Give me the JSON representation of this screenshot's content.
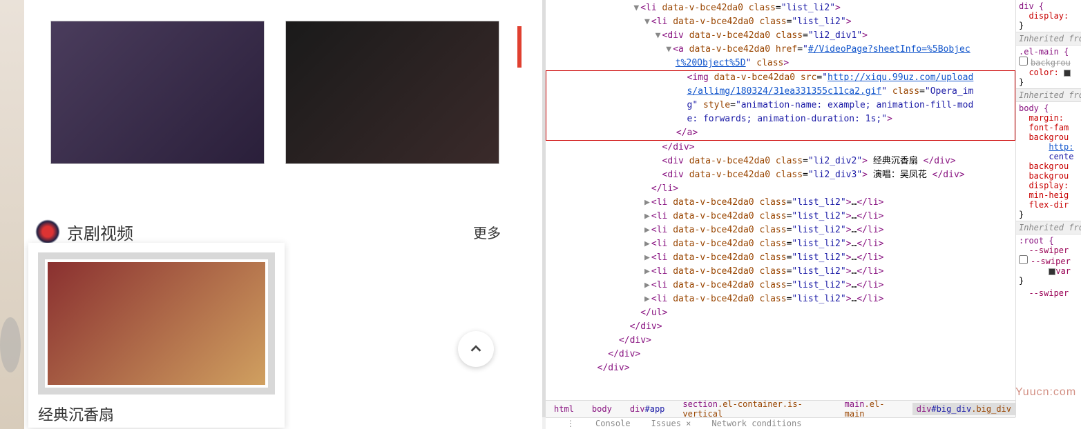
{
  "page": {
    "section_title": "京剧视频",
    "more_label": "更多",
    "card_caption": "经典沉香扇"
  },
  "devtools": {
    "lines": [
      {
        "indent": 8,
        "arrow": "▼",
        "pre": "<",
        "tag": "li",
        "attrs": [
          [
            "data-v-bce42da0",
            ""
          ],
          [
            "class",
            "list_li2"
          ]
        ],
        "post": ">",
        "fade": true,
        "partial_top": true
      },
      {
        "indent": 9,
        "arrow": "▼",
        "pre": "<",
        "tag": "li",
        "attrs": [
          [
            "data-v-bce42da0",
            ""
          ],
          [
            "class",
            "list_li2"
          ]
        ],
        "post": ">"
      },
      {
        "indent": 10,
        "arrow": "▼",
        "pre": "<",
        "tag": "div",
        "attrs": [
          [
            "data-v-bce42da0",
            ""
          ],
          [
            "class",
            "li2_div1"
          ]
        ],
        "post": ">"
      },
      {
        "indent": 11,
        "arrow": "▼",
        "pre": "<",
        "tag": "a",
        "attrs": [
          [
            "data-v-bce42da0",
            ""
          ]
        ],
        "href": "#/VideoPage?sheetInfo=%5Bobject%20Object%5D",
        "trail_attrs": [
          [
            "class",
            ""
          ]
        ],
        "post": "",
        "multiline_a": true
      },
      {
        "indent": 12,
        "arrow": "",
        "img_open": true,
        "box_start": true
      },
      {
        "indent": 12,
        "img_cont1": true
      },
      {
        "indent": 12,
        "img_cont2": true
      },
      {
        "indent": 12,
        "close_a": true,
        "box_end": true
      },
      {
        "indent": 10,
        "arrow": "",
        "pre": "</",
        "tag": "div",
        "post": ">"
      },
      {
        "indent": 10,
        "arrow": "",
        "pre": "<",
        "tag": "div",
        "attrs": [
          [
            "data-v-bce42da0",
            ""
          ],
          [
            "class",
            "li2_div2"
          ]
        ],
        "post": ">",
        "text": " 经典沉香扇 ",
        "close": "div"
      },
      {
        "indent": 10,
        "arrow": "",
        "pre": "<",
        "tag": "div",
        "attrs": [
          [
            "data-v-bce42da0",
            ""
          ],
          [
            "class",
            "li2_div3"
          ]
        ],
        "post": ">",
        "text": " 演唱：吴凤花 ",
        "close": "div"
      },
      {
        "indent": 9,
        "arrow": "",
        "pre": "</",
        "tag": "li",
        "post": ">"
      },
      {
        "indent": 9,
        "arrow": "▶",
        "pre": "<",
        "tag": "li",
        "attrs": [
          [
            "data-v-bce42da0",
            ""
          ],
          [
            "class",
            "list_li2"
          ]
        ],
        "post": ">",
        "ell": true,
        "close": "li"
      },
      {
        "indent": 9,
        "arrow": "▶",
        "pre": "<",
        "tag": "li",
        "attrs": [
          [
            "data-v-bce42da0",
            ""
          ],
          [
            "class",
            "list_li2"
          ]
        ],
        "post": ">",
        "ell": true,
        "close": "li"
      },
      {
        "indent": 9,
        "arrow": "▶",
        "pre": "<",
        "tag": "li",
        "attrs": [
          [
            "data-v-bce42da0",
            ""
          ],
          [
            "class",
            "list_li2"
          ]
        ],
        "post": ">",
        "ell": true,
        "close": "li"
      },
      {
        "indent": 9,
        "arrow": "▶",
        "pre": "<",
        "tag": "li",
        "attrs": [
          [
            "data-v-bce42da0",
            ""
          ],
          [
            "class",
            "list_li2"
          ]
        ],
        "post": ">",
        "ell": true,
        "close": "li"
      },
      {
        "indent": 9,
        "arrow": "▶",
        "pre": "<",
        "tag": "li",
        "attrs": [
          [
            "data-v-bce42da0",
            ""
          ],
          [
            "class",
            "list_li2"
          ]
        ],
        "post": ">",
        "ell": true,
        "close": "li"
      },
      {
        "indent": 9,
        "arrow": "▶",
        "pre": "<",
        "tag": "li",
        "attrs": [
          [
            "data-v-bce42da0",
            ""
          ],
          [
            "class",
            "list_li2"
          ]
        ],
        "post": ">",
        "ell": true,
        "close": "li"
      },
      {
        "indent": 9,
        "arrow": "▶",
        "pre": "<",
        "tag": "li",
        "attrs": [
          [
            "data-v-bce42da0",
            ""
          ],
          [
            "class",
            "list_li2"
          ]
        ],
        "post": ">",
        "ell": true,
        "close": "li"
      },
      {
        "indent": 9,
        "arrow": "▶",
        "pre": "<",
        "tag": "li",
        "attrs": [
          [
            "data-v-bce42da0",
            ""
          ],
          [
            "class",
            "list_li2"
          ]
        ],
        "post": ">",
        "ell": true,
        "close": "li"
      },
      {
        "indent": 8,
        "arrow": "",
        "pre": "</",
        "tag": "ul",
        "post": ">"
      },
      {
        "indent": 7,
        "arrow": "",
        "pre": "</",
        "tag": "div",
        "post": ">"
      },
      {
        "indent": 6,
        "arrow": "",
        "pre": "</",
        "tag": "div",
        "post": ">"
      },
      {
        "indent": 5,
        "arrow": "",
        "pre": "</",
        "tag": "div",
        "post": ">"
      },
      {
        "indent": 4,
        "arrow": "",
        "pre": "</",
        "tag": "div",
        "post": ">"
      }
    ],
    "img_src": "http://xiqu.99uz.com/uploads/allimg/180324/31ea331355c11ca2.gif",
    "img_class": "Opera_img",
    "img_style": "animation-name: example; animation-fill-mode: forwards; animation-duration: 1s;",
    "crumbs": [
      {
        "t": "html",
        "kind": "tag"
      },
      {
        "t": "body",
        "kind": "tag"
      },
      {
        "t": "div#app",
        "kind": "tagid"
      },
      {
        "t": "section.el-container.is-vertical",
        "kind": "tagcls"
      },
      {
        "t": "main.el-main",
        "kind": "tagcls"
      },
      {
        "t": "div#big_div.big_div",
        "kind": "tagidcls",
        "on": true
      }
    ],
    "drawer": {
      "console": "Console",
      "issues": "Issues",
      "netcond": "Network conditions"
    }
  },
  "styles": {
    "blocks": [
      {
        "sep": "",
        "sel": "div {",
        "props": [
          {
            "k": "display:",
            "v": ""
          }
        ],
        "close": "}"
      },
      {
        "sep": "Inherited from",
        "sel": ".el-main {",
        "props": [
          {
            "cb": true,
            "k": "backgrou",
            "strk": true
          },
          {
            "k": "color:",
            "swatch": true
          }
        ],
        "close": "}"
      },
      {
        "sep": "Inherited from",
        "sel": "body {",
        "props": [
          {
            "k": "margin:",
            "v": ""
          },
          {
            "k": "font-fam",
            "v": ""
          },
          {
            "k": "backgrou",
            "v": ""
          },
          {
            "k2": "http:",
            "link": true
          },
          {
            "k2": "cente",
            "v": ""
          },
          {
            "k": "backgrou",
            "v": ""
          },
          {
            "k": "backgrou",
            "v": ""
          },
          {
            "k": "display:",
            "v": ""
          },
          {
            "k": "min-heig",
            "v": ""
          },
          {
            "k": "flex-dir",
            "v": ""
          }
        ],
        "close": "}"
      },
      {
        "sep": "Inherited from",
        "sel": ":root {",
        "props": [
          {
            "k3": "--swiper",
            "strk": false
          },
          {
            "cb": true,
            "k3": "--swiper",
            "strk": true
          },
          {
            "k3v": "var",
            "swatch": true,
            "strk": true
          }
        ],
        "close": "}"
      },
      {
        "sep": "",
        "sel": "",
        "props": [
          {
            "k3": "--swiper"
          }
        ]
      }
    ],
    "watermark": "Yuucn:com"
  }
}
